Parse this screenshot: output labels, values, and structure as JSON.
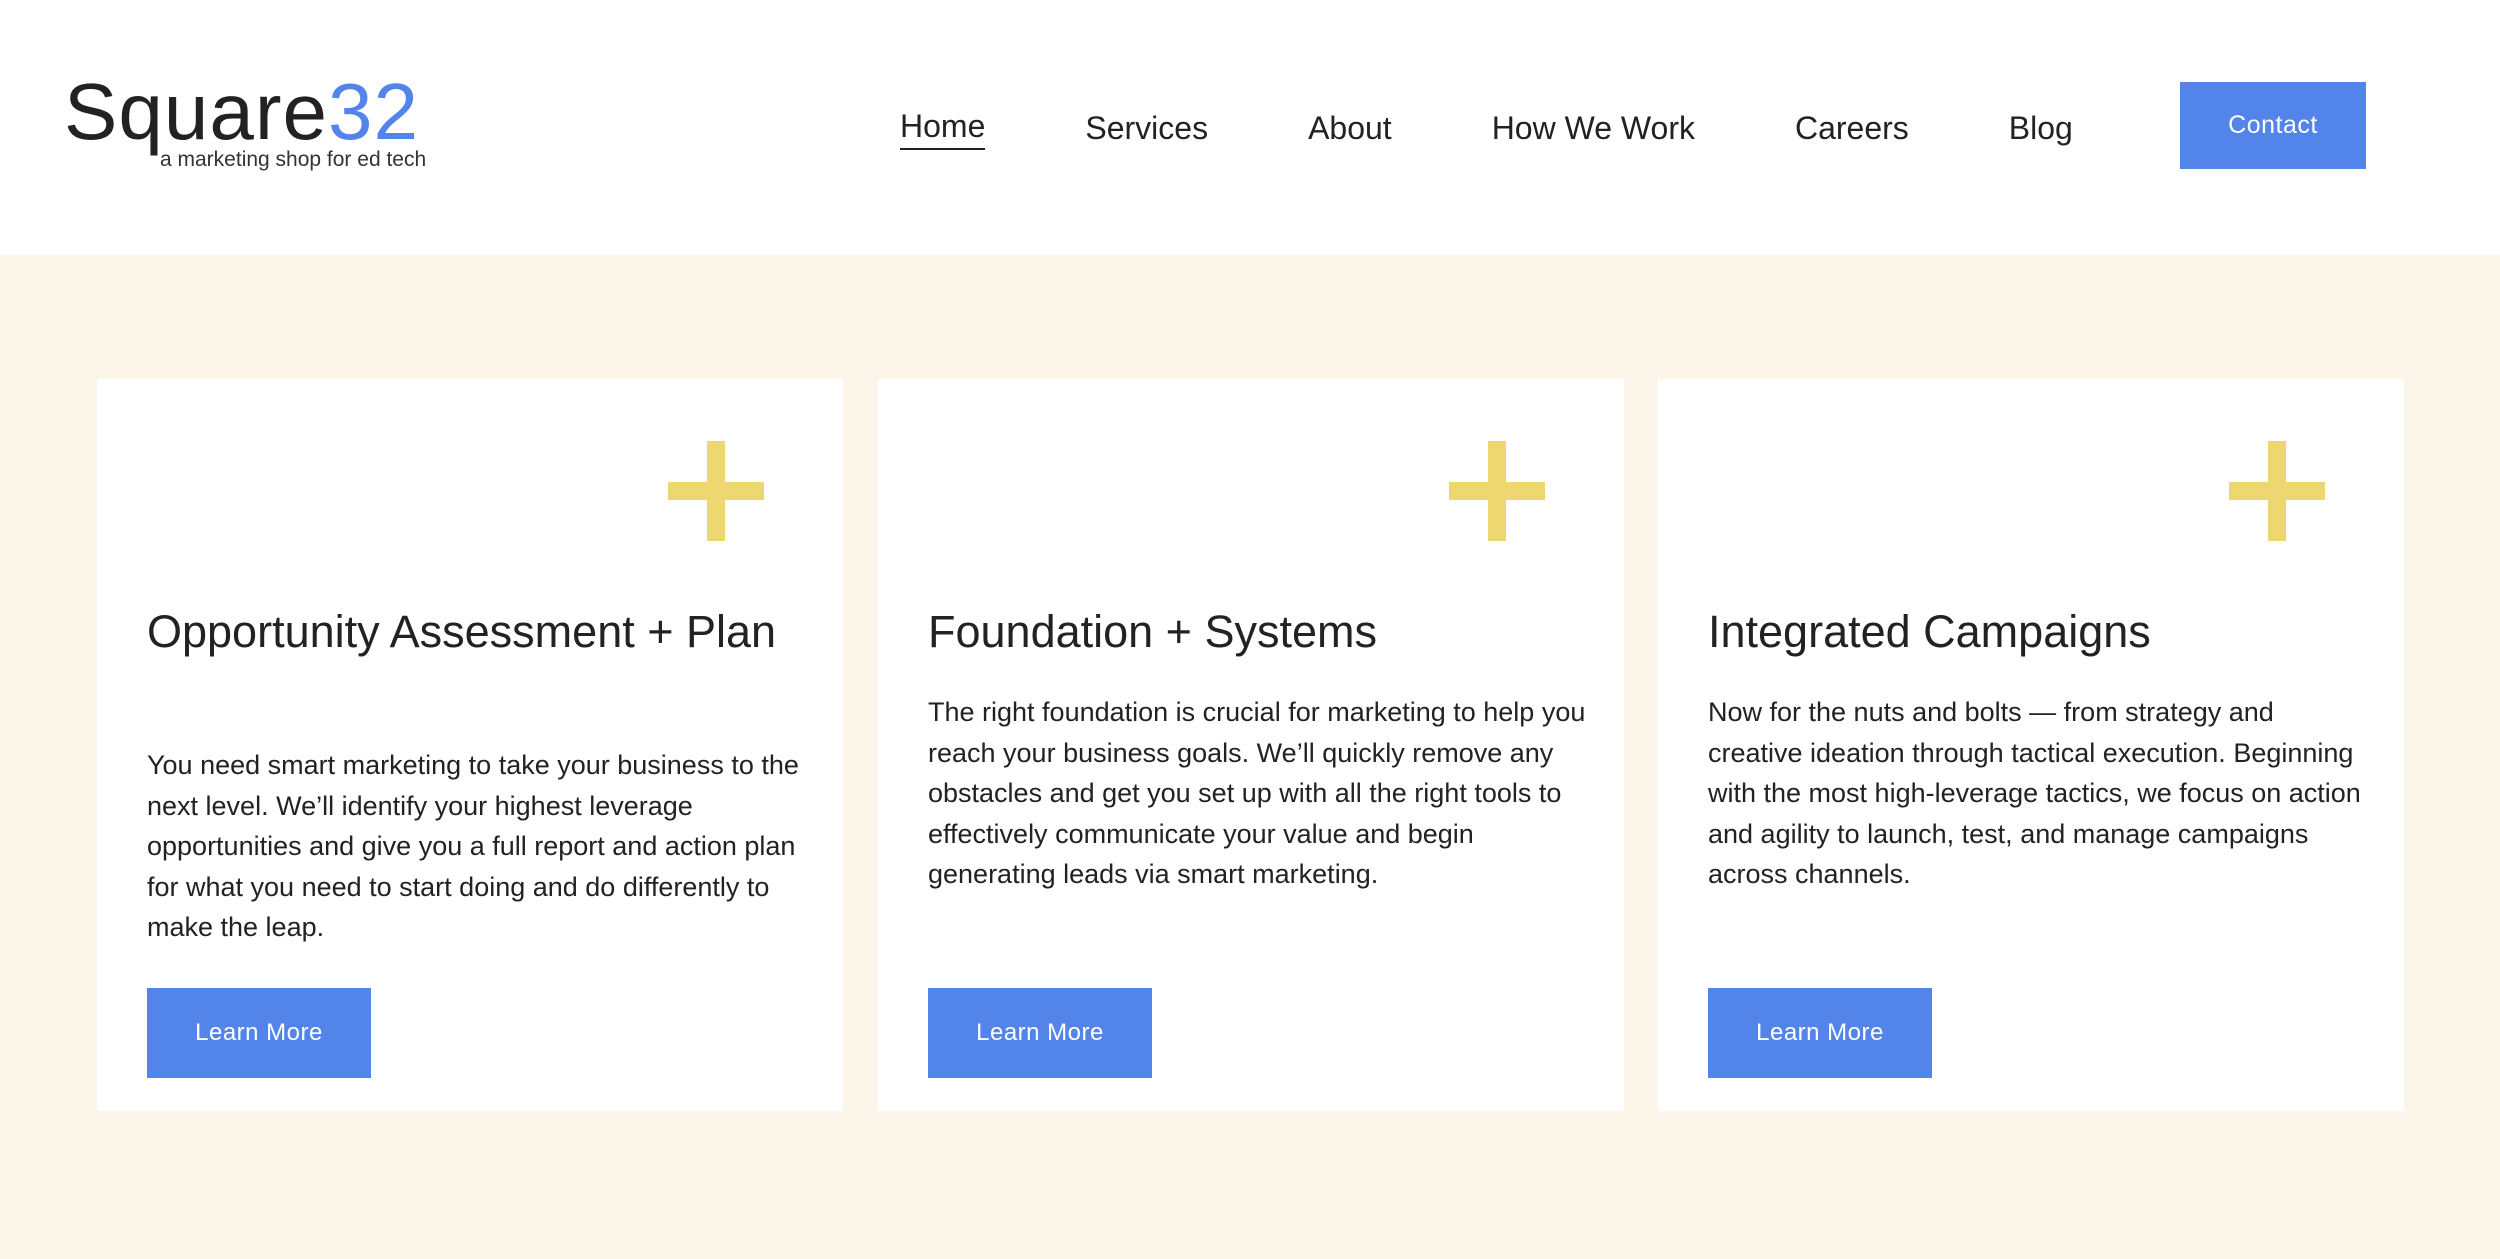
{
  "brand": {
    "name_main": "Square",
    "name_accent": "32",
    "tagline": "a marketing shop for ed tech",
    "accent_color": "#5284e9"
  },
  "nav": {
    "items": [
      {
        "label": "Home",
        "active": true
      },
      {
        "label": "Services",
        "active": false
      },
      {
        "label": "About",
        "active": false
      },
      {
        "label": "How We Work",
        "active": false
      },
      {
        "label": "Careers",
        "active": false
      },
      {
        "label": "Blog",
        "active": false
      }
    ],
    "contact_label": "Contact"
  },
  "colors": {
    "band_background": "#fcf5ea",
    "plus_icon": "#eed770",
    "button": "#5284e9"
  },
  "cards": [
    {
      "icon": "plus-icon",
      "title": "Opportunity Assessment + Plan",
      "body": "You need smart marketing to take your business to the next level. We’ll identify your highest leverage opportunities and give you a full report and action plan for what you need to start doing and do differently to make the leap.",
      "button_label": "Learn More"
    },
    {
      "icon": "plus-icon",
      "title": "Foundation + Systems",
      "body": "The right foundation is crucial for marketing to help you reach your business goals. We’ll quickly remove any obstacles and get you set up with all the right tools to effectively communicate your value and begin generating leads via smart marketing.",
      "button_label": "Learn More"
    },
    {
      "icon": "plus-icon",
      "title": "Integrated Campaigns",
      "body": "Now for the nuts and bolts — from strategy and creative ideation through tactical execution. Beginning with the most high-leverage tactics, we focus on action and agility to launch, test, and manage campaigns across channels.",
      "button_label": "Learn More"
    }
  ]
}
